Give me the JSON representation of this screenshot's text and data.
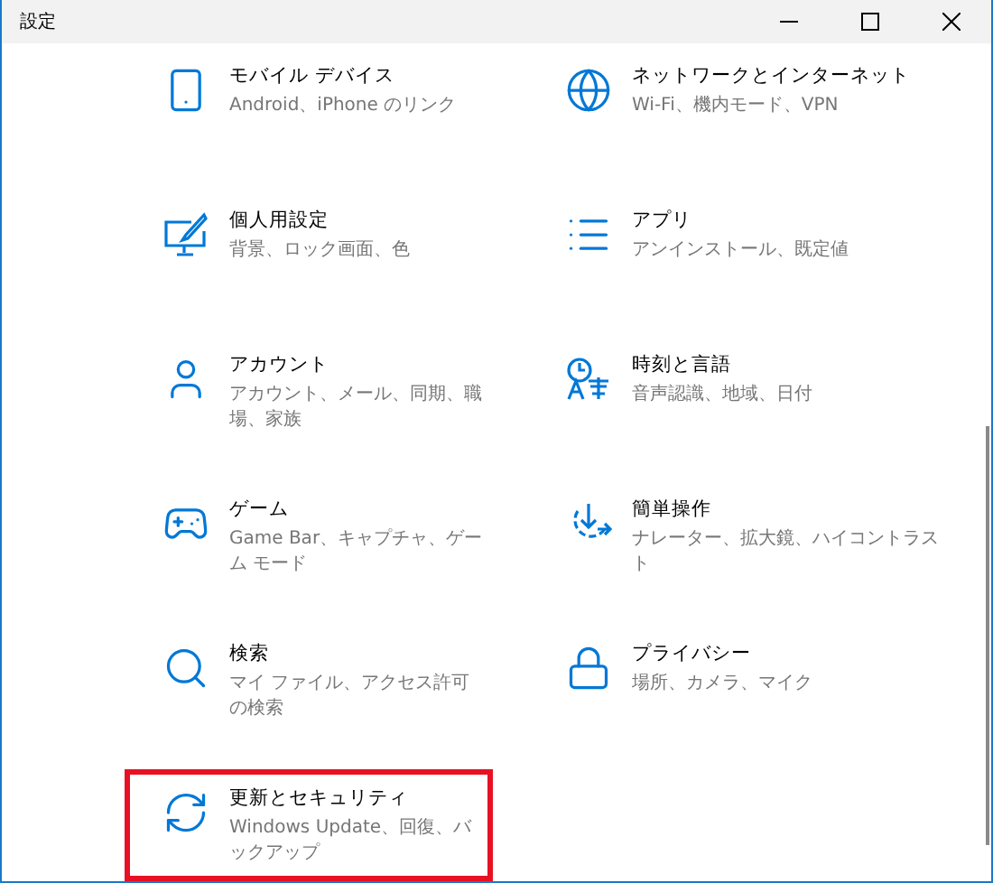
{
  "window": {
    "title": "設定"
  },
  "items": [
    {
      "title": "モバイル デバイス",
      "description": "Android、iPhone のリンク",
      "highlighted": false
    },
    {
      "title": "ネットワークとインターネット",
      "description": "Wi-Fi、機内モード、VPN",
      "highlighted": false
    },
    {
      "title": "個人用設定",
      "description": "背景、ロック画面、色",
      "highlighted": false
    },
    {
      "title": "アプリ",
      "description": "アンインストール、既定値",
      "highlighted": false
    },
    {
      "title": "アカウント",
      "description": "アカウント、メール、同期、職場、家族",
      "highlighted": false
    },
    {
      "title": "時刻と言語",
      "description": "音声認識、地域、日付",
      "highlighted": false
    },
    {
      "title": "ゲーム",
      "description": "Game Bar、キャプチャ、ゲーム モード",
      "highlighted": false
    },
    {
      "title": "簡単操作",
      "description": "ナレーター、拡大鏡、ハイコントラスト",
      "highlighted": false
    },
    {
      "title": "検索",
      "description": "マイ ファイル、アクセス許可の検索",
      "highlighted": false
    },
    {
      "title": "プライバシー",
      "description": "場所、カメラ、マイク",
      "highlighted": false
    },
    {
      "title": "更新とセキュリティ",
      "description": "Windows Update、回復、バックアップ",
      "highlighted": true
    }
  ]
}
